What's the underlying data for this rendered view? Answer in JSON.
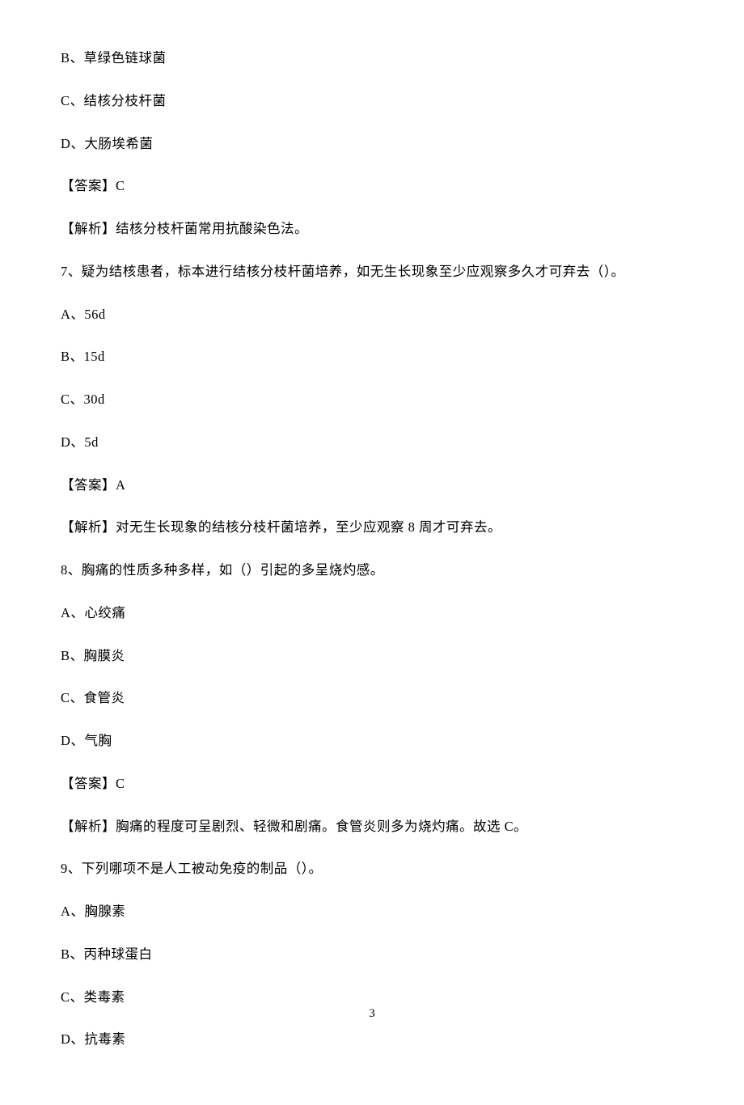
{
  "lines": {
    "l0": "B、草绿色链球菌",
    "l1": "C、结核分枝杆菌",
    "l2": "D、大肠埃希菌",
    "l3": "【答案】C",
    "l4": "【解析】结核分枝杆菌常用抗酸染色法。",
    "l5": "7、疑为结核患者，标本进行结核分枝杆菌培养，如无生长现象至少应观察多久才可弃去（）。",
    "l6": "A、56d",
    "l7": "B、15d",
    "l8": "C、30d",
    "l9": "D、5d",
    "l10": "【答案】A",
    "l11": "【解析】对无生长现象的结核分枝杆菌培养，至少应观察 8 周才可弃去。",
    "l12": "8、胸痛的性质多种多样，如（）引起的多呈烧灼感。",
    "l13": "A、心绞痛",
    "l14": "B、胸膜炎",
    "l15": "C、食管炎",
    "l16": "D、气胸",
    "l17": "【答案】C",
    "l18": "【解析】胸痛的程度可呈剧烈、轻微和剧痛。食管炎则多为烧灼痛。故选 C。",
    "l19": "9、下列哪项不是人工被动免疫的制品（）。",
    "l20": "A、胸腺素",
    "l21": "B、丙种球蛋白",
    "l22": "C、类毒素",
    "l23": "D、抗毒素"
  },
  "pageNumber": "3"
}
